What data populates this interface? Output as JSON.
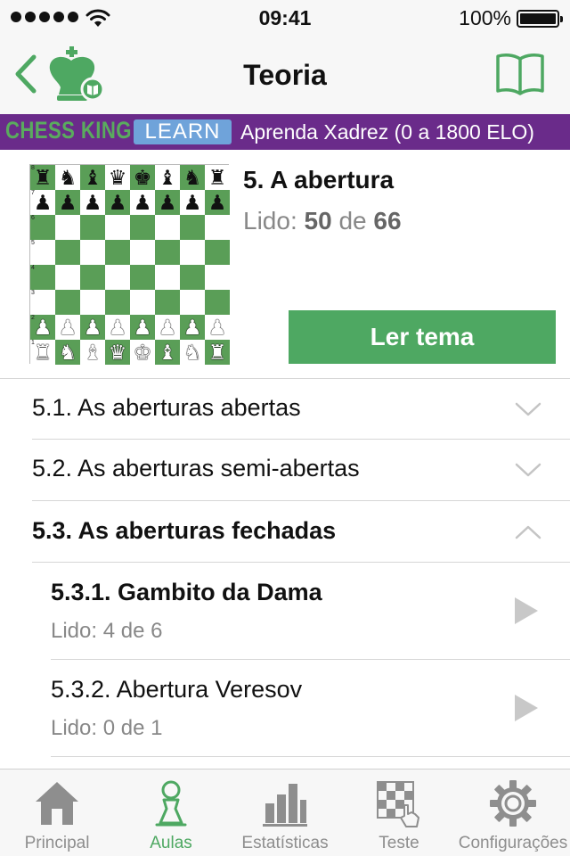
{
  "status": {
    "time": "09:41",
    "battery": "100%"
  },
  "nav": {
    "title": "Teoria"
  },
  "banner": {
    "brand": "CHESS KING",
    "badge": "LEARN",
    "subtitle": "Aprenda Xadrez (0 a 1800 ELO)"
  },
  "topic": {
    "title": "5. A abertura",
    "progress_prefix": "Lido:",
    "progress_read": "50",
    "progress_mid": "de",
    "progress_total": "66",
    "read_button": "Ler tema",
    "board_ranks": [
      "8",
      "7",
      "6",
      "5",
      "4",
      "3",
      "2",
      "1"
    ]
  },
  "sections": [
    {
      "label": "5.1. As aberturas abertas"
    },
    {
      "label": "5.2. As aberturas semi-abertas"
    },
    {
      "label": "5.3. As aberturas fechadas"
    }
  ],
  "subsections": [
    {
      "title": "5.3.1. Gambito da Dama",
      "progress": "Lido: 4 de 6"
    },
    {
      "title": "5.3.2. Abertura Veresov",
      "progress": "Lido: 0 de 1"
    }
  ],
  "tabs": [
    {
      "label": "Principal",
      "icon": "house-icon"
    },
    {
      "label": "Aulas",
      "icon": "pawn-icon"
    },
    {
      "label": "Estatísticas",
      "icon": "bar-chart-icon"
    },
    {
      "label": "Teste",
      "icon": "board-touch-icon"
    },
    {
      "label": "Configurações",
      "icon": "gear-icon"
    }
  ],
  "colors": {
    "accent": "#4ea862",
    "banner": "#6a2b8a",
    "learn_badge": "#6fa3da"
  }
}
